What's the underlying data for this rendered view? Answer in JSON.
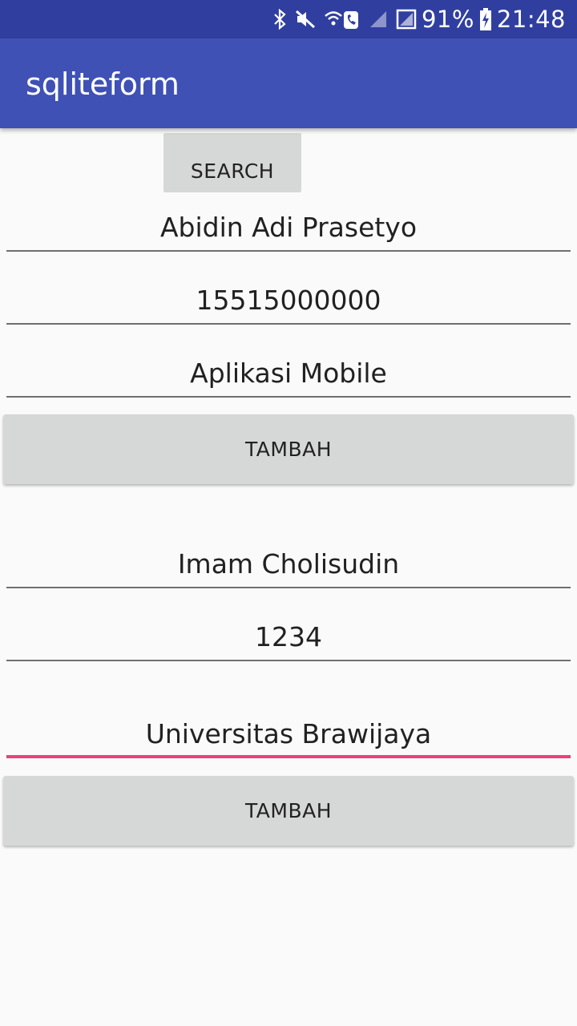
{
  "status_bar": {
    "battery_percent": "91%",
    "time": "21:48",
    "icons": [
      "bluetooth-icon",
      "mute-icon",
      "wifi-call-icon",
      "signal-icon",
      "no-sim-icon",
      "battery-charging-icon"
    ]
  },
  "app_bar": {
    "title": "sqliteform"
  },
  "search_button": "SEARCH",
  "form1": {
    "name": "Abidin Adi Prasetyo",
    "number": "15515000000",
    "subject": "Aplikasi Mobile",
    "submit": "TAMBAH"
  },
  "form2": {
    "name": "Imam Cholisudin",
    "number": "1234",
    "subject": "Universitas Brawijaya",
    "submit": "TAMBAH"
  },
  "colors": {
    "status_bar": "#303f9f",
    "app_bar": "#3f51b5",
    "accent": "#ec407a",
    "button": "#d6d7d7",
    "background": "#fafafa"
  }
}
